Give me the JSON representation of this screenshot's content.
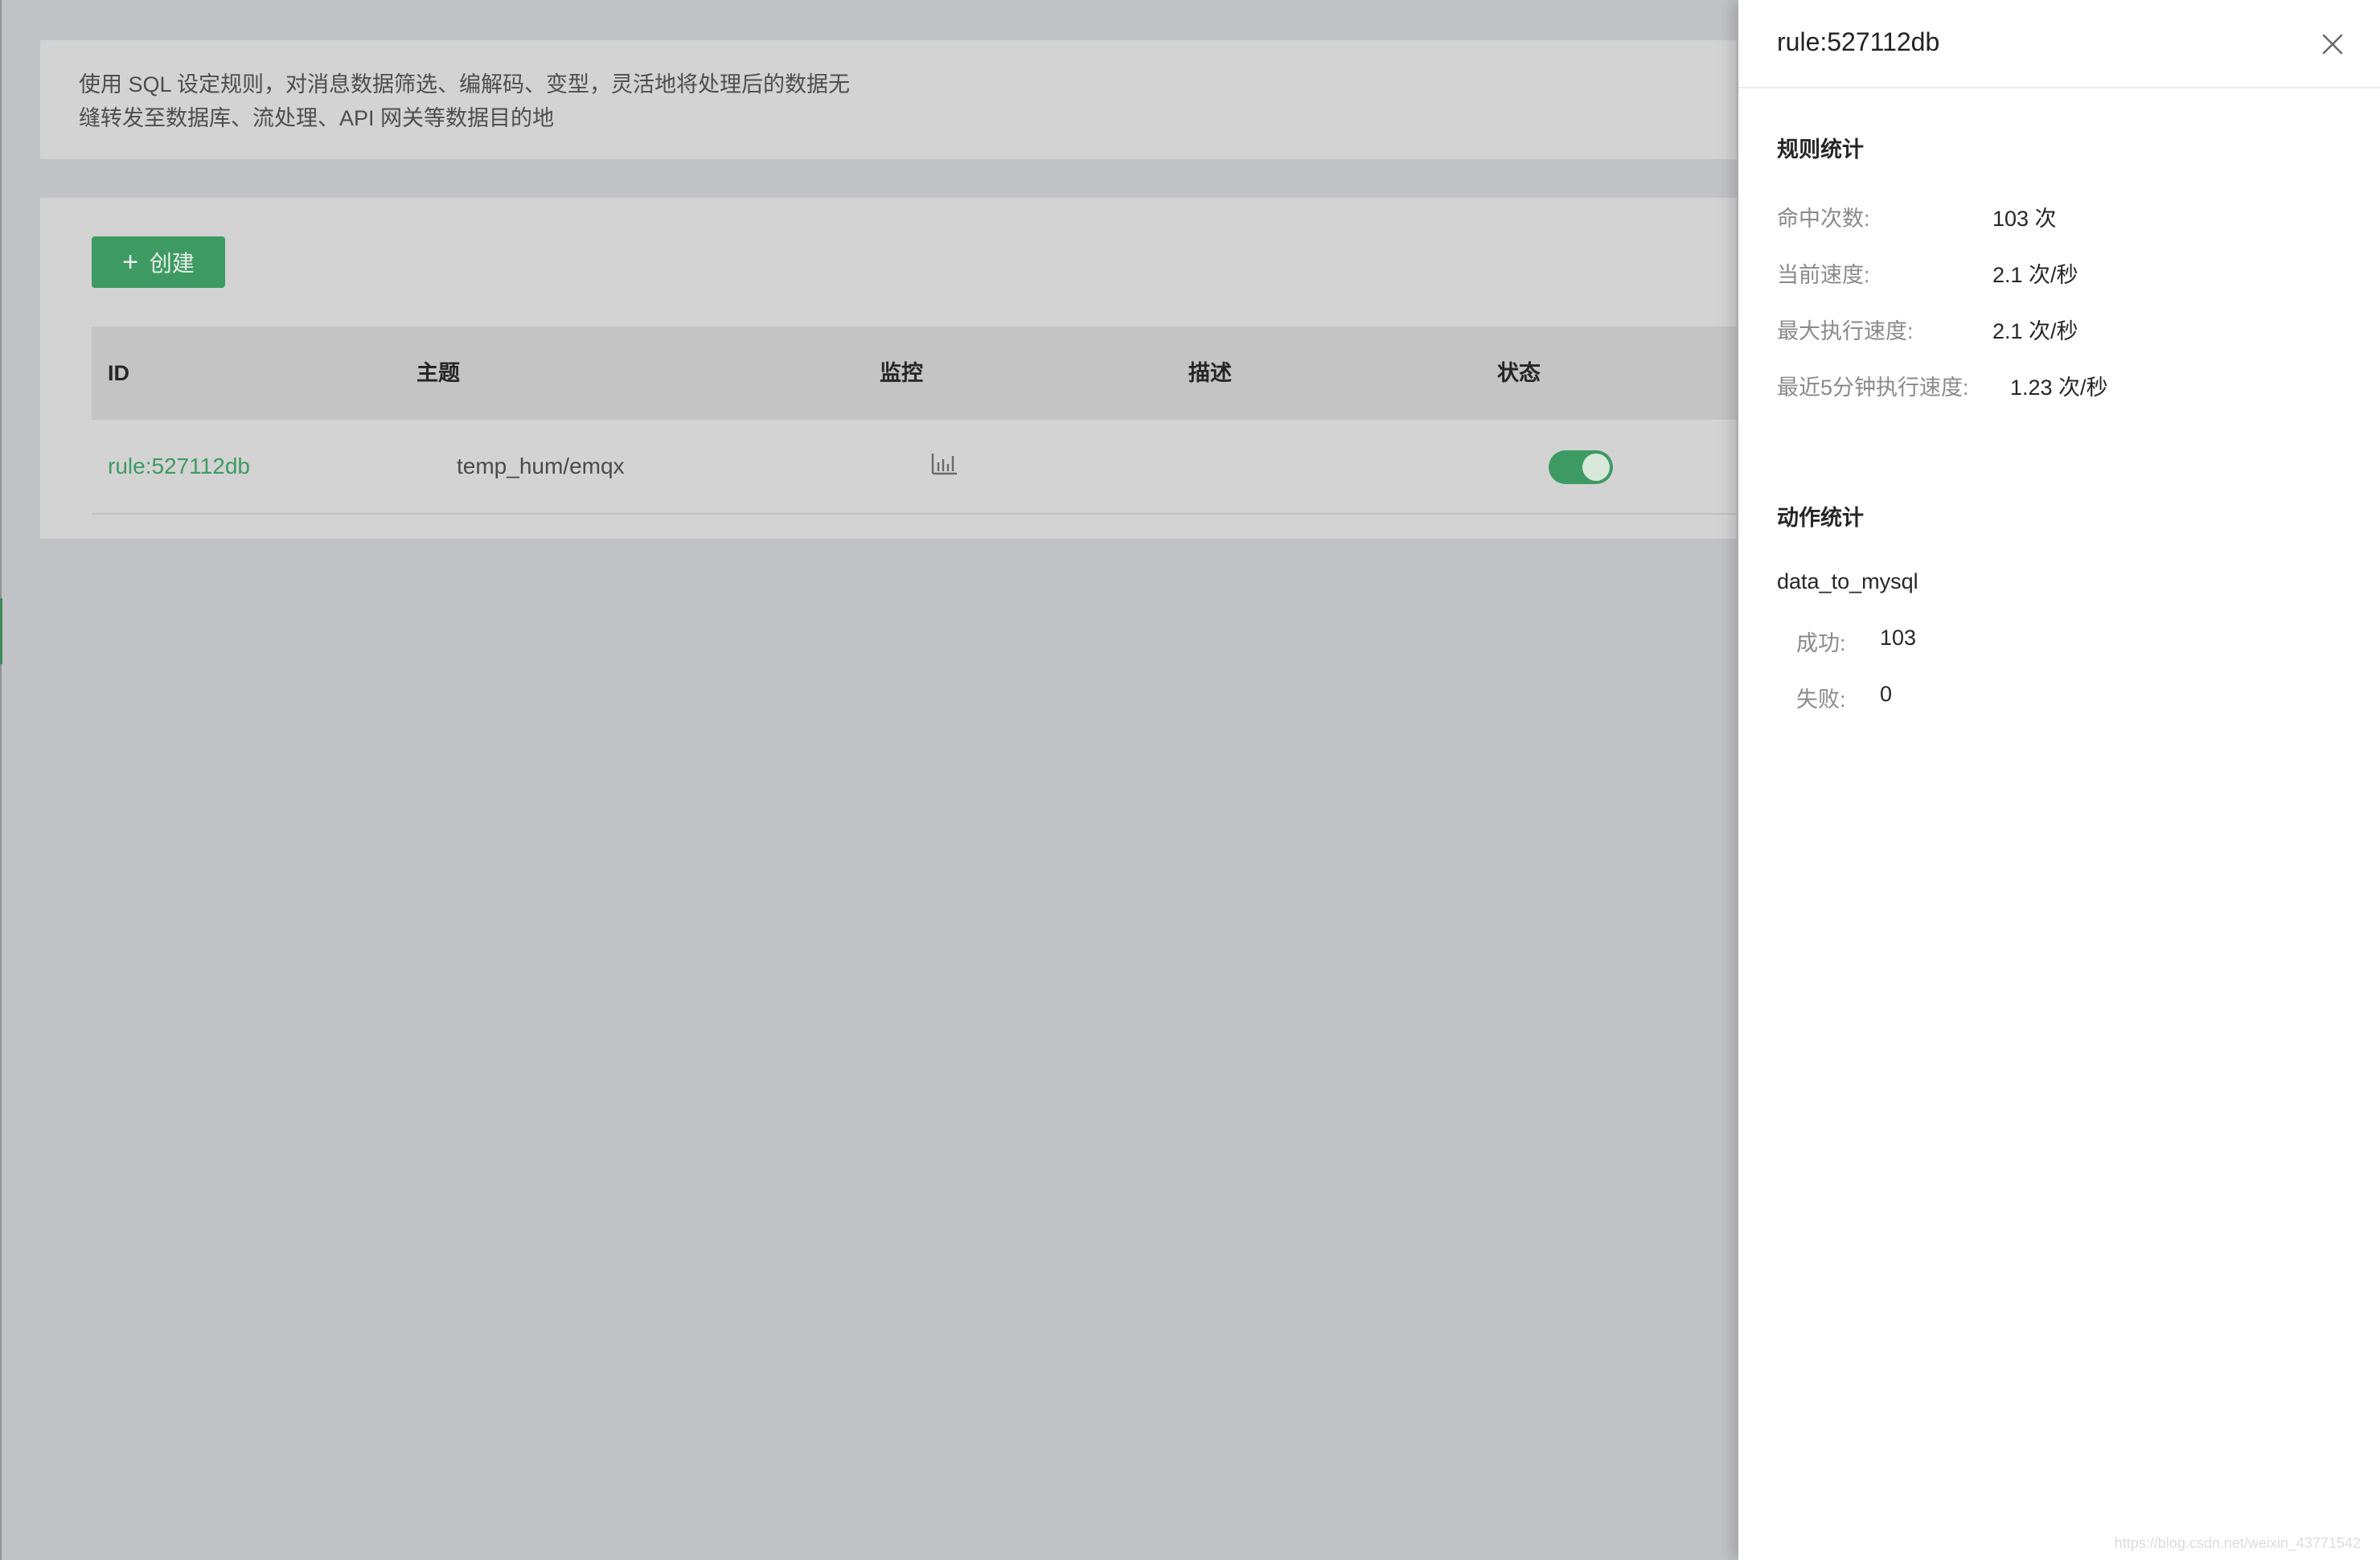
{
  "description": {
    "line1": "使用 SQL 设定规则，对消息数据筛选、编解码、变型，灵活地将处理后的数据无",
    "line2": "缝转发至数据库、流处理、API 网关等数据目的地"
  },
  "toolbar": {
    "create_label": "创建"
  },
  "table": {
    "headers": {
      "id": "ID",
      "topic": "主题",
      "monitor": "监控",
      "description": "描述",
      "status": "状态"
    },
    "rows": [
      {
        "id": "rule:527112db",
        "topic": "temp_hum/emqx",
        "description": "",
        "status_enabled": true
      }
    ]
  },
  "drawer": {
    "title": "rule:527112db",
    "rule_stats": {
      "title": "规则统计",
      "items": [
        {
          "label": "命中次数:",
          "value": "103 次"
        },
        {
          "label": "当前速度:",
          "value": "2.1 次/秒"
        },
        {
          "label": "最大执行速度:",
          "value": "2.1 次/秒"
        },
        {
          "label": "最近5分钟执行速度:",
          "value": "1.23 次/秒"
        }
      ]
    },
    "action_stats": {
      "title": "动作统计",
      "actions": [
        {
          "name": "data_to_mysql",
          "success_label": "成功:",
          "success": "103",
          "failed_label": "失败:",
          "failed": "0"
        }
      ]
    }
  },
  "colors": {
    "accent": "#3e9a63",
    "overlay": "#c1c2c5"
  },
  "watermark": "https://blog.csdn.net/weixin_43771542"
}
